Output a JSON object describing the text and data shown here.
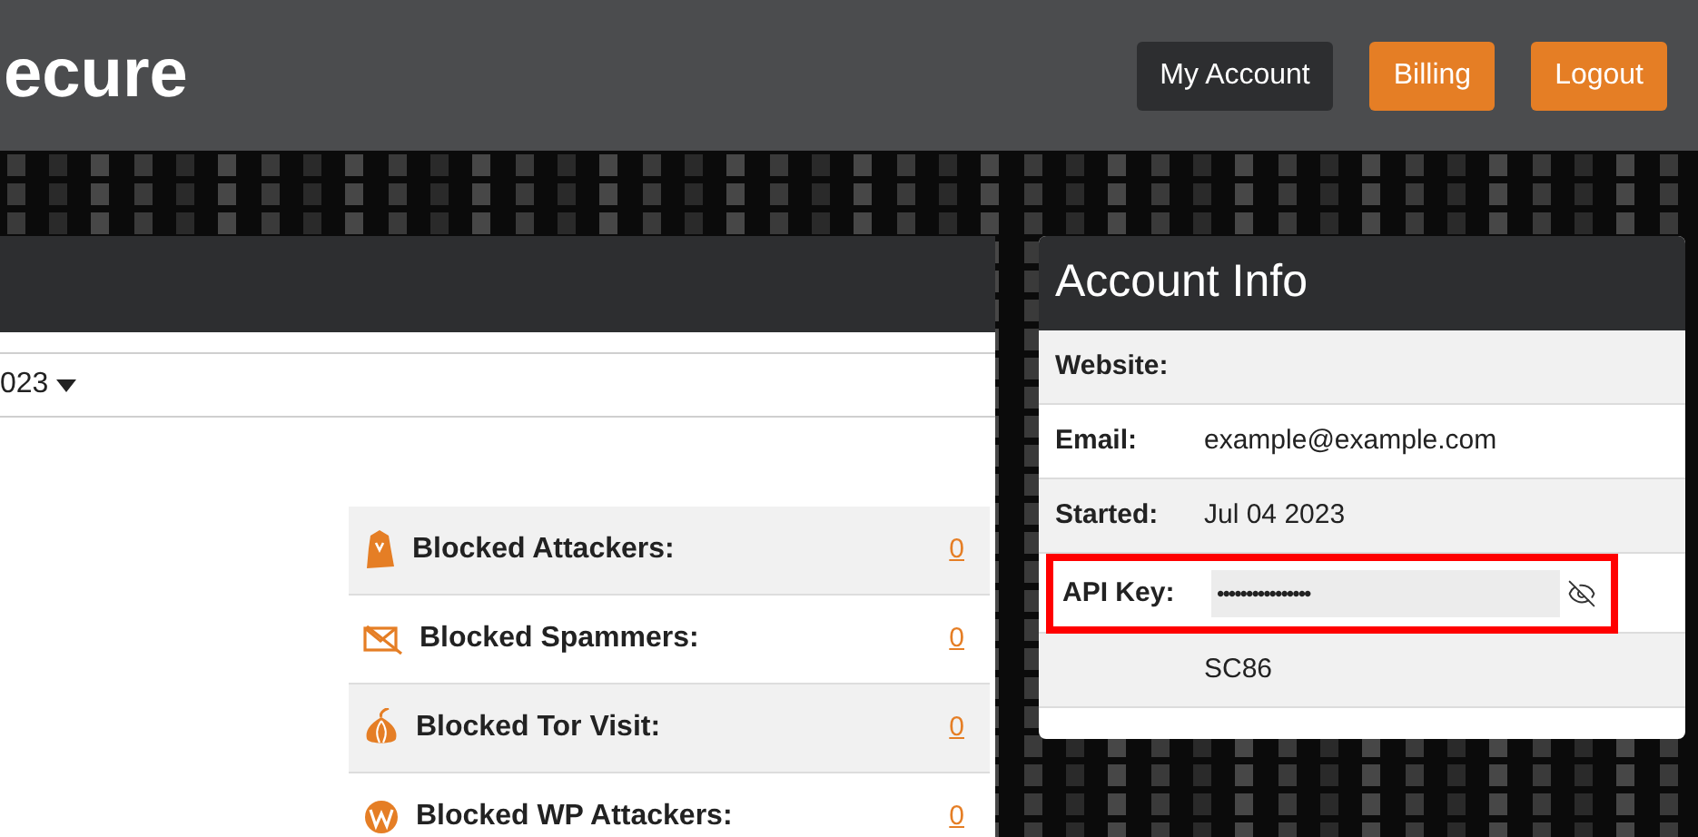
{
  "header": {
    "brand": "ecure",
    "buttons": [
      {
        "label": "My Account",
        "kind": "dark"
      },
      {
        "label": "Billing",
        "kind": "accent"
      },
      {
        "label": "Logout",
        "kind": "accent"
      }
    ]
  },
  "panel": {
    "date_dropdown": "023",
    "stats": [
      {
        "kind": "attacker",
        "label": "Blocked Attackers:",
        "value": "0"
      },
      {
        "kind": "spam",
        "label": "Blocked Spammers:",
        "value": "0"
      },
      {
        "kind": "tor",
        "label": "Blocked Tor Visit:",
        "value": "0"
      },
      {
        "kind": "wordpress",
        "label": "Blocked WP Attackers:",
        "value": "0"
      }
    ]
  },
  "account_info": {
    "title": "Account Info",
    "rows": [
      {
        "kind": "text",
        "label": "Website:",
        "highlighted": false
      },
      {
        "kind": "text",
        "label": "Email:",
        "value": "example@example.com",
        "highlighted": false
      },
      {
        "kind": "text",
        "label": "Started:",
        "value": "Jul 04 2023",
        "highlighted": false
      },
      {
        "kind": "secret",
        "label": "API Key:",
        "value": "••••••••••••••••",
        "highlighted": true
      },
      {
        "kind": "text",
        "value": "SC86",
        "highlighted": false
      }
    ]
  }
}
